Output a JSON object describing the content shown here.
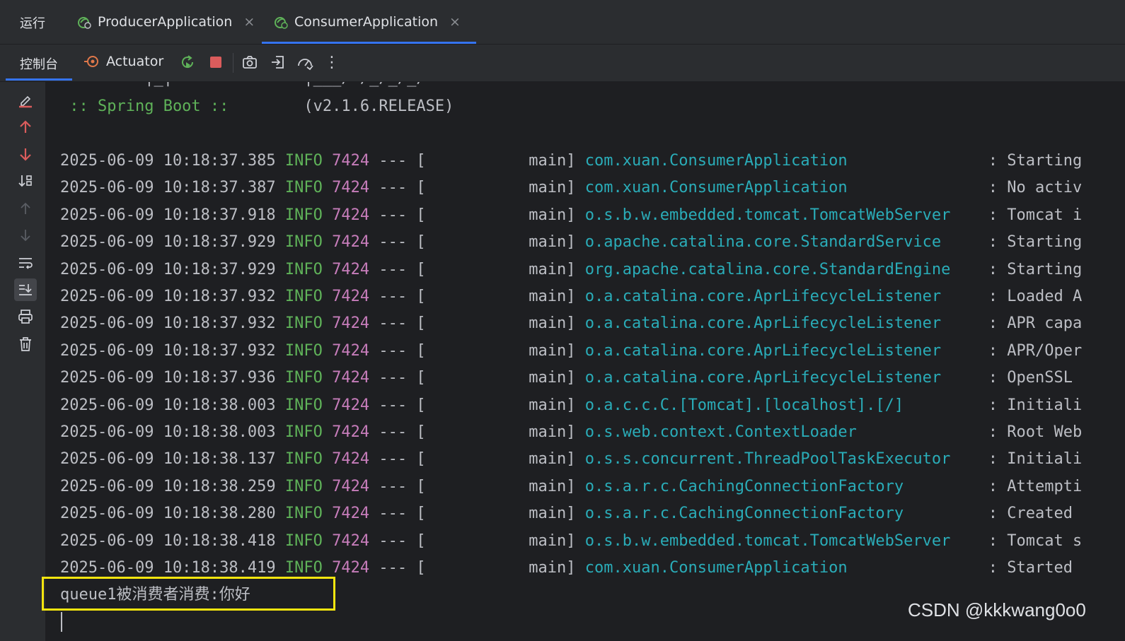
{
  "run_panel": {
    "title": "运行",
    "tabs": [
      {
        "label": "ProducerApplication",
        "close": "×",
        "active": false
      },
      {
        "label": "ConsumerApplication",
        "close": "×",
        "active": true
      }
    ]
  },
  "toolbar": {
    "console_tab": "控制台",
    "actuator_tab": "Actuator",
    "more": "⋮",
    "icons": [
      "rerun-icon",
      "stop-icon",
      "screenshot-icon",
      "exit-icon",
      "dump-icon"
    ]
  },
  "side_gutter_icons": [
    "clear-icon",
    "up-arrow-icon",
    "down-arrow-icon",
    "sort-icon",
    "prev-occurrence-icon",
    "next-occurrence-icon",
    "soft-wrap-icon",
    "scroll-to-end-icon",
    "print-icon",
    "trash-icon"
  ],
  "console": {
    "banner_art": "=========|_|==============|___/=/_/_/_/",
    "spring_boot_label": " :: Spring Boot ::",
    "spring_boot_version": "(v2.1.6.RELEASE)",
    "logs": [
      {
        "timestamp": "2025-06-09 10:18:37.385",
        "level": "INFO",
        "pid": "7424",
        "sep": "--- [",
        "thread": "           main]",
        "logger": "com.xuan.ConsumerApplication",
        "message": ": Starting"
      },
      {
        "timestamp": "2025-06-09 10:18:37.387",
        "level": "INFO",
        "pid": "7424",
        "sep": "--- [",
        "thread": "           main]",
        "logger": "com.xuan.ConsumerApplication",
        "message": ": No activ"
      },
      {
        "timestamp": "2025-06-09 10:18:37.918",
        "level": "INFO",
        "pid": "7424",
        "sep": "--- [",
        "thread": "           main]",
        "logger": "o.s.b.w.embedded.tomcat.TomcatWebServer",
        "message": ": Tomcat i"
      },
      {
        "timestamp": "2025-06-09 10:18:37.929",
        "level": "INFO",
        "pid": "7424",
        "sep": "--- [",
        "thread": "           main]",
        "logger": "o.apache.catalina.core.StandardService",
        "message": ": Starting"
      },
      {
        "timestamp": "2025-06-09 10:18:37.929",
        "level": "INFO",
        "pid": "7424",
        "sep": "--- [",
        "thread": "           main]",
        "logger": "org.apache.catalina.core.StandardEngine",
        "message": ": Starting"
      },
      {
        "timestamp": "2025-06-09 10:18:37.932",
        "level": "INFO",
        "pid": "7424",
        "sep": "--- [",
        "thread": "           main]",
        "logger": "o.a.catalina.core.AprLifecycleListener",
        "message": ": Loaded A"
      },
      {
        "timestamp": "2025-06-09 10:18:37.932",
        "level": "INFO",
        "pid": "7424",
        "sep": "--- [",
        "thread": "           main]",
        "logger": "o.a.catalina.core.AprLifecycleListener",
        "message": ": APR capa"
      },
      {
        "timestamp": "2025-06-09 10:18:37.932",
        "level": "INFO",
        "pid": "7424",
        "sep": "--- [",
        "thread": "           main]",
        "logger": "o.a.catalina.core.AprLifecycleListener",
        "message": ": APR/Oper"
      },
      {
        "timestamp": "2025-06-09 10:18:37.936",
        "level": "INFO",
        "pid": "7424",
        "sep": "--- [",
        "thread": "           main]",
        "logger": "o.a.catalina.core.AprLifecycleListener",
        "message": ": OpenSSL"
      },
      {
        "timestamp": "2025-06-09 10:18:38.003",
        "level": "INFO",
        "pid": "7424",
        "sep": "--- [",
        "thread": "           main]",
        "logger": "o.a.c.c.C.[Tomcat].[localhost].[/]",
        "message": ": Initiali"
      },
      {
        "timestamp": "2025-06-09 10:18:38.003",
        "level": "INFO",
        "pid": "7424",
        "sep": "--- [",
        "thread": "           main]",
        "logger": "o.s.web.context.ContextLoader",
        "message": ": Root Web"
      },
      {
        "timestamp": "2025-06-09 10:18:38.137",
        "level": "INFO",
        "pid": "7424",
        "sep": "--- [",
        "thread": "           main]",
        "logger": "o.s.s.concurrent.ThreadPoolTaskExecutor",
        "message": ": Initiali"
      },
      {
        "timestamp": "2025-06-09 10:18:38.259",
        "level": "INFO",
        "pid": "7424",
        "sep": "--- [",
        "thread": "           main]",
        "logger": "o.s.a.r.c.CachingConnectionFactory",
        "message": ": Attempti"
      },
      {
        "timestamp": "2025-06-09 10:18:38.280",
        "level": "INFO",
        "pid": "7424",
        "sep": "--- [",
        "thread": "           main]",
        "logger": "o.s.a.r.c.CachingConnectionFactory",
        "message": ": Created"
      },
      {
        "timestamp": "2025-06-09 10:18:38.418",
        "level": "INFO",
        "pid": "7424",
        "sep": "--- [",
        "thread": "           main]",
        "logger": "o.s.b.w.embedded.tomcat.TomcatWebServer",
        "message": ": Tomcat s"
      },
      {
        "timestamp": "2025-06-09 10:18:38.419",
        "level": "INFO",
        "pid": "7424",
        "sep": "--- [",
        "thread": "           main]",
        "logger": "com.xuan.ConsumerApplication",
        "message": ": Started"
      }
    ],
    "consumed_message": "queue1被消费者消费:你好"
  },
  "watermark": "CSDN @kkkwang0o0",
  "colors": {
    "background": "#1e1f22",
    "panel": "#2b2d30",
    "accent": "#3574f0",
    "info_level": "#5fb259",
    "pid": "#c77dbb",
    "logger": "#2aacb8",
    "highlight_box": "#f5e50f"
  }
}
